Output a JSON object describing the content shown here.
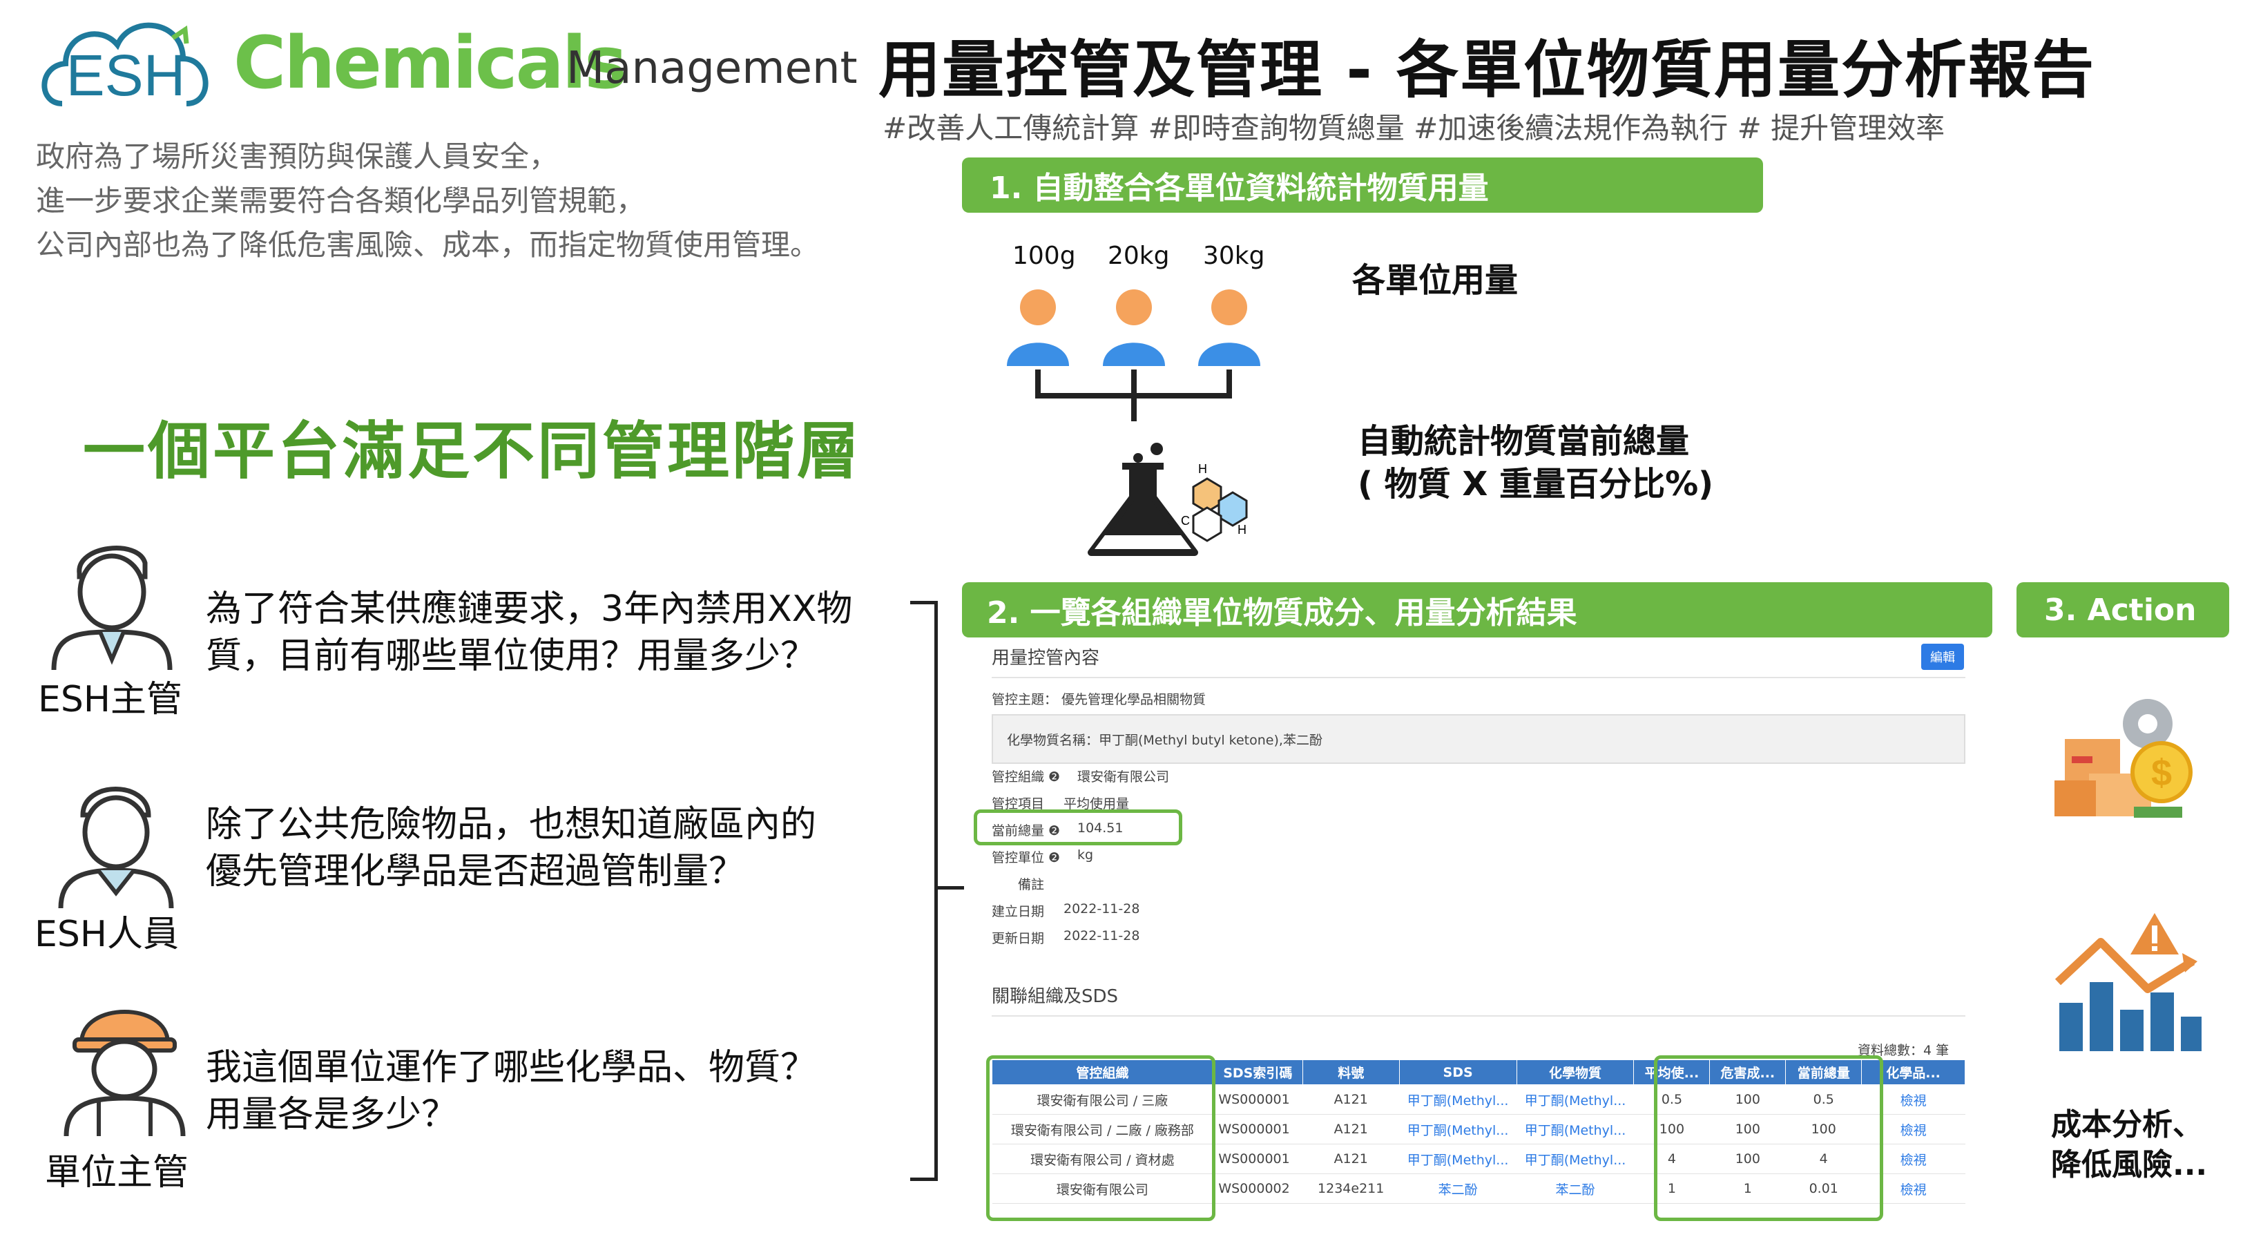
{
  "logo": {
    "esh": "ESH",
    "chemicals": "Chemicals",
    "management": "Management"
  },
  "intro_lines": [
    "政府為了場所災害預防與保護人員安全，",
    "進一步要求企業需要符合各類化學品列管規範，",
    "公司內部也為了降低危害風險、成本，而指定物質使用管理。"
  ],
  "title": "用量控管及管理 - 各單位物質用量分析報告",
  "hashtags": "#改善人工傳統計算 #即時查詢物質總量 #加速後續法規作為執行 # 提升管理效率",
  "section1": {
    "label": "1. 自動整合各單位資料統計物質用量",
    "amounts": [
      "100g",
      "20kg",
      "30kg"
    ],
    "unit_usage_label": "各單位用量",
    "total_label_line1": "自動統計物質當前總量",
    "total_label_line2": "( 物質 X 重量百分比%)"
  },
  "headline": "一個平台滿足不同管理階層",
  "roles": [
    {
      "name": "ESH主管",
      "question_lines": [
        "為了符合某供應鏈要求，3年內禁用XX物",
        "質，目前有哪些單位使用？用量多少？"
      ]
    },
    {
      "name": "ESH人員",
      "question_lines": [
        "除了公共危險物品，也想知道廠區內的",
        "優先管理化學品是否超過管制量？"
      ]
    },
    {
      "name": "單位主管",
      "question_lines": [
        "我這個單位運作了哪些化學品、物質？",
        "用量各是多少？"
      ]
    }
  ],
  "section2": {
    "label": "2. 一覽各組織單位物質成分、用量分析結果",
    "panel_title": "用量控管內容",
    "edit_button": "編輯",
    "subject": "管控主題： 優先管理化學品相關物質",
    "chemical_name": "化學物質名稱：甲丁酮(Methyl butyl ketone),苯二酚",
    "fields": [
      {
        "label": "管控組織 ❷",
        "value": "環安衛有限公司"
      },
      {
        "label": "管控項目",
        "value": "平均使用量"
      },
      {
        "label": "當前總量 ❷",
        "value": "104.51"
      },
      {
        "label": "管控單位 ❷",
        "value": "kg"
      },
      {
        "label": "備註",
        "value": ""
      },
      {
        "label": "建立日期",
        "value": "2022-11-28"
      },
      {
        "label": "更新日期",
        "value": "2022-11-28"
      }
    ],
    "related_title": "關聯組織及SDS",
    "record_count": "資料總數：4 筆",
    "table": {
      "headers": [
        "管控組織",
        "SDS索引碼",
        "料號",
        "SDS",
        "化學物質",
        "平均使...",
        "危害成...",
        "當前總量",
        "化學品..."
      ],
      "rows": [
        [
          "環安衛有限公司 / 三廠",
          "WS000001",
          "A121",
          "甲丁酮(Methyl...",
          "甲丁酮(Methyl...",
          "0.5",
          "100",
          "0.5",
          "檢視"
        ],
        [
          "環安衛有限公司 / 二廠 / 廠務部",
          "WS000001",
          "A121",
          "甲丁酮(Methyl...",
          "甲丁酮(Methyl...",
          "100",
          "100",
          "100",
          "檢視"
        ],
        [
          "環安衛有限公司 / 資材處",
          "WS000001",
          "A121",
          "甲丁酮(Methyl...",
          "甲丁酮(Methyl...",
          "4",
          "100",
          "4",
          "檢視"
        ],
        [
          "環安衛有限公司",
          "WS000002",
          "1234e211",
          "苯二酚",
          "苯二酚",
          "1",
          "1",
          "0.01",
          "檢視"
        ]
      ]
    }
  },
  "section3": {
    "label": "3. Action",
    "cost_line1": "成本分析、",
    "cost_line2": "降低風險..."
  },
  "colors": {
    "green": "#6cb744",
    "blue": "#3a79c5",
    "orange": "#f5a35c",
    "person_blue": "#3b8fe6"
  }
}
